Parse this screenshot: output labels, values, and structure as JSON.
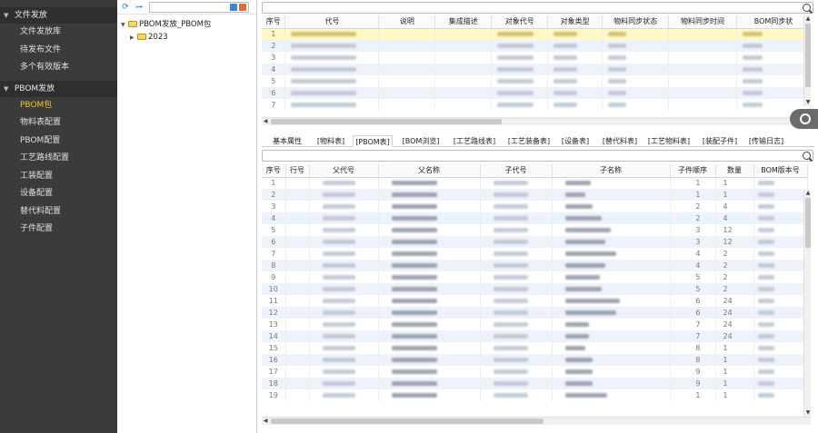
{
  "nav": {
    "groups": [
      {
        "label": "文件发放",
        "items": [
          "文件发放库",
          "待发布文件",
          "多个有效版本"
        ]
      },
      {
        "label": "PBOM发放",
        "items": [
          "PBOM包",
          "物料表配置",
          "PBOM配置",
          "工艺路线配置",
          "工装配置",
          "设备配置",
          "替代料配置",
          "子件配置"
        ]
      }
    ],
    "active_item": "PBOM包"
  },
  "tree": {
    "search_placeholder": "",
    "root": "PBOM发放_PBOM包",
    "child": "2023"
  },
  "top_search": {
    "placeholder": ""
  },
  "top_table": {
    "columns": [
      "序号",
      "代号",
      "说明",
      "集成描述",
      "对象代号",
      "对象类型",
      "物料同步状态",
      "物料同步时间",
      "BOM同步状"
    ],
    "row_numbers": [
      "1",
      "2",
      "3",
      "4",
      "5",
      "6",
      "7"
    ],
    "selected_row": 1
  },
  "tabs": [
    "基本属性",
    "[物料表]",
    "[PBOM表]",
    "[BOM浏览]",
    "[工艺路线表]",
    "[工艺装备表]",
    "[设备表]",
    "[替代料表]",
    "[工艺物料表]",
    "[装配子件]",
    "[传输日志]"
  ],
  "active_tab": "[PBOM表]",
  "bottom_search": {
    "placeholder": ""
  },
  "bottom_table": {
    "columns": [
      "序号",
      "行号",
      "父代号",
      "父名称",
      "子代号",
      "子名称",
      "子件顺序",
      "数量",
      "BOM版本号"
    ],
    "row_numbers": [
      "1",
      "2",
      "3",
      "4",
      "5",
      "6",
      "7",
      "8",
      "9",
      "10",
      "11",
      "12",
      "13",
      "14",
      "15",
      "16",
      "17",
      "18",
      "19"
    ],
    "sequence": [
      "1",
      "1",
      "2",
      "2",
      "3",
      "3",
      "4",
      "4",
      "5",
      "5",
      "6",
      "6",
      "7",
      "7",
      "8",
      "8",
      "9",
      "9",
      "1"
    ],
    "quantity": [
      "1",
      "1",
      "4",
      "4",
      "12",
      "12",
      "2",
      "2",
      "2",
      "2",
      "24",
      "24",
      "24",
      "24",
      "1",
      "1",
      "1",
      "1",
      "1"
    ]
  },
  "colors": {
    "nav_bg": "#3b3b3b",
    "nav_active": "#f2c232",
    "row_selected": "#fff9c6",
    "row_stripe": "#eef3fb"
  }
}
